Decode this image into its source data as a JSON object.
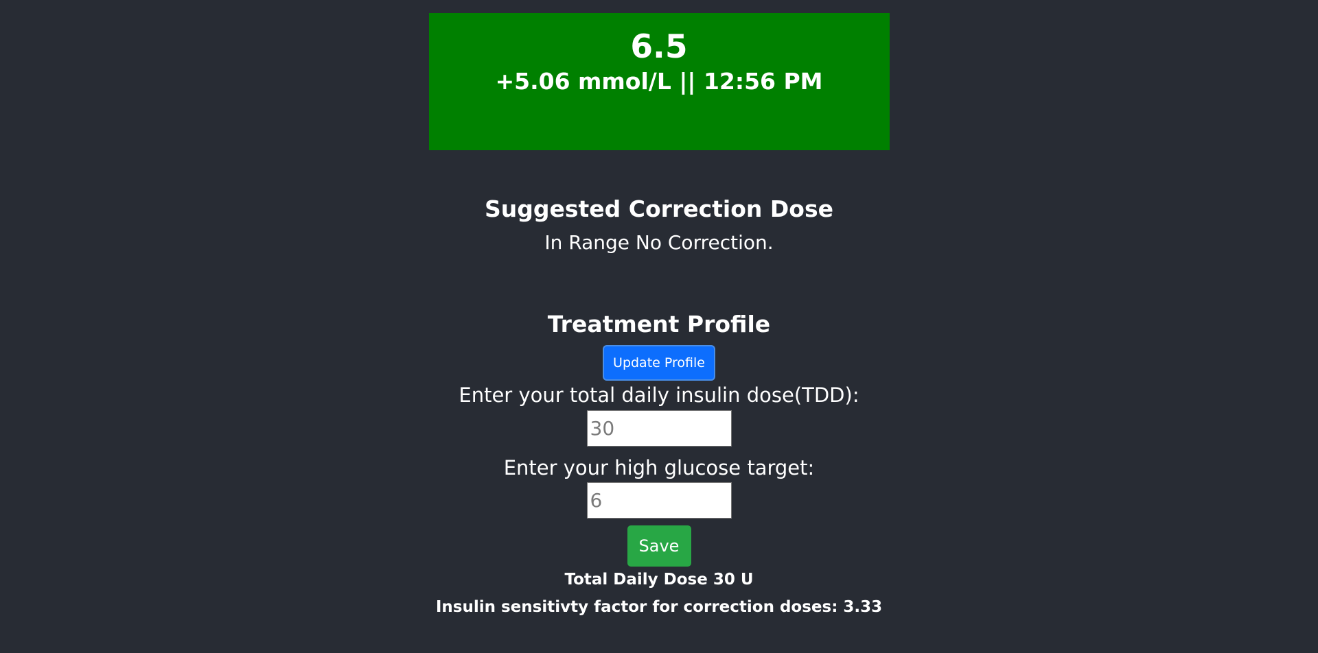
{
  "glucose_card": {
    "value": "6.5",
    "meta": "+5.06 mmol/L || 12:56 PM",
    "background_color": "#008000"
  },
  "correction": {
    "title": "Suggested Correction Dose",
    "text": "In Range No Correction."
  },
  "profile": {
    "title": "Treatment Profile",
    "update_button_label": "Update Profile",
    "tdd_label": "Enter your total daily insulin dose(TDD):",
    "tdd_placeholder": "30",
    "target_label": "Enter your high glucose target:",
    "target_placeholder": "6",
    "save_button_label": "Save",
    "total_daily_dose_text": "Total Daily Dose 30 U",
    "isf_text": "Insulin sensitivty factor for correction doses: 3.33"
  },
  "colors": {
    "page_background": "#282c34",
    "update_button": "#0d6efd",
    "save_button": "#28a745"
  }
}
